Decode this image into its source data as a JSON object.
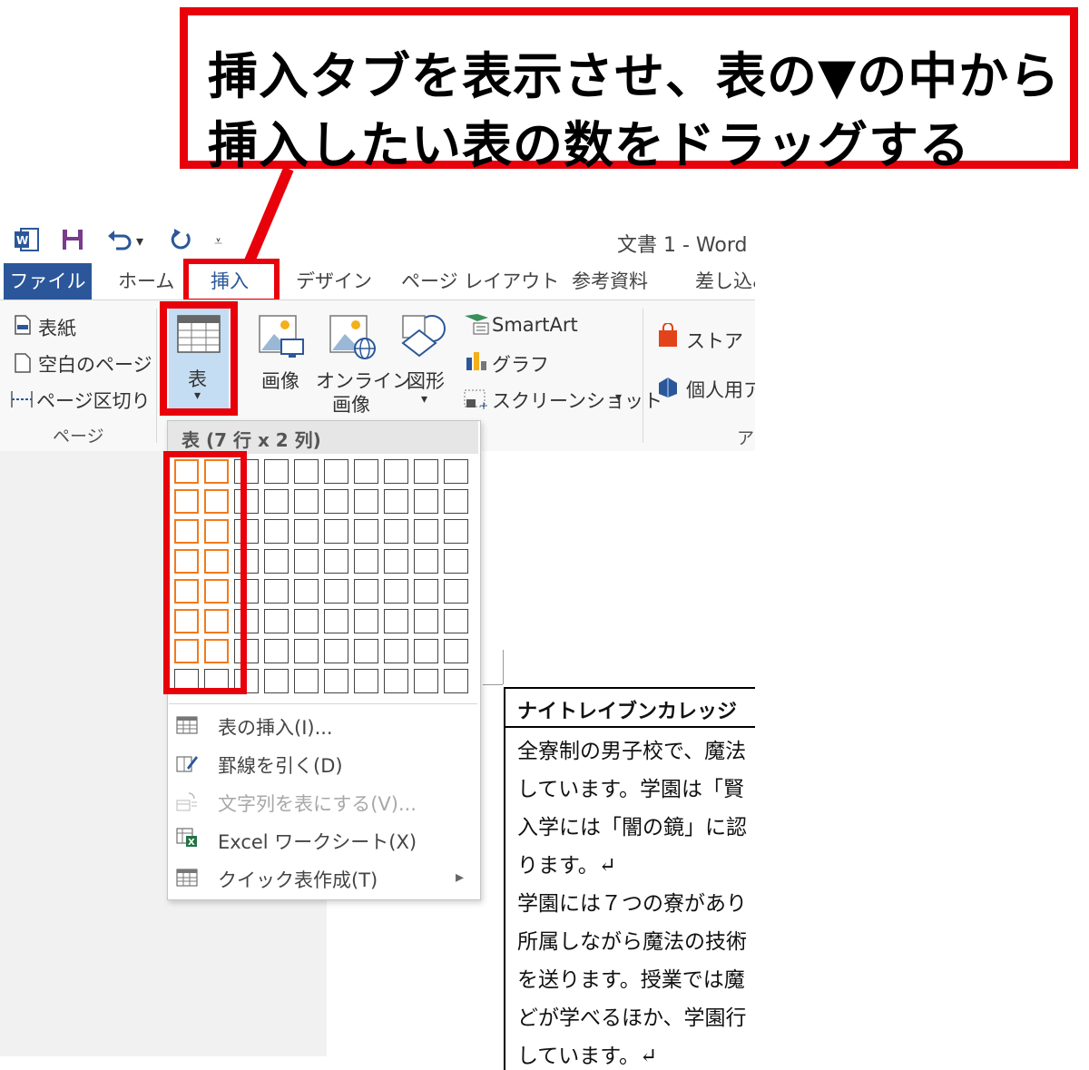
{
  "callout": {
    "line1": "挿入タブを表示させ、表の▼の中から",
    "line2": "挿入したい表の数をドラッグする"
  },
  "titlebar": {
    "undo_arrow": "▾",
    "customize": "⩡",
    "doc_title": "文書 1 - Word"
  },
  "tabs": [
    "ファイル",
    "ホーム",
    "挿入",
    "デザイン",
    "ページ レイアウト",
    "参考資料",
    "差し込み"
  ],
  "ribbon": {
    "pages": {
      "cover": "表紙",
      "blank": "空白のページ",
      "break": "ページ区切り",
      "group_label": "ページ"
    },
    "table_label": "表",
    "table_arrow": "▾",
    "picture_label": "画像",
    "online_picture_label": [
      "オンライン",
      "画像"
    ],
    "shapes_label": "図形",
    "shapes_arrow": "▾",
    "smartart": "SmartArt",
    "chart": "グラフ",
    "screenshot": "スクリーンショット",
    "screenshot_arrow": "▾",
    "store": "ストア",
    "my_addins": "個人用ア",
    "addins_group_label": "ア"
  },
  "dropdown": {
    "title": "表 (7 行 x 2 列)",
    "grid_cols": 10,
    "grid_rows": 8,
    "selected_rows": 7,
    "selected_cols": 2,
    "items": [
      {
        "label": "表の挿入(I)...",
        "enabled": true
      },
      {
        "label": "罫線を引く(D)",
        "enabled": true
      },
      {
        "label": "文字列を表にする(V)...",
        "enabled": false
      },
      {
        "label": "Excel ワークシート(X)",
        "enabled": true
      },
      {
        "label": "クイック表作成(T)",
        "enabled": true
      }
    ],
    "submenu_arrow": "▸"
  },
  "document": {
    "table_header": "ナイトレイブンカレッジ",
    "lines": [
      "全寮制の男子校で、魔法",
      "しています。学園は「賢",
      "入学には「闇の鏡」に認",
      "ります。↵",
      "学園には７つの寮があり",
      "所属しながら魔法の技術",
      "を送ります。授業では魔",
      "どが学べるほか、学園行",
      "しています。↵"
    ]
  },
  "colors": {
    "accent_red": "#e8000b",
    "file_tab": "#2b579a",
    "grid_selected": "#f27a1a",
    "table_button_bg": "#c5ddf3"
  }
}
